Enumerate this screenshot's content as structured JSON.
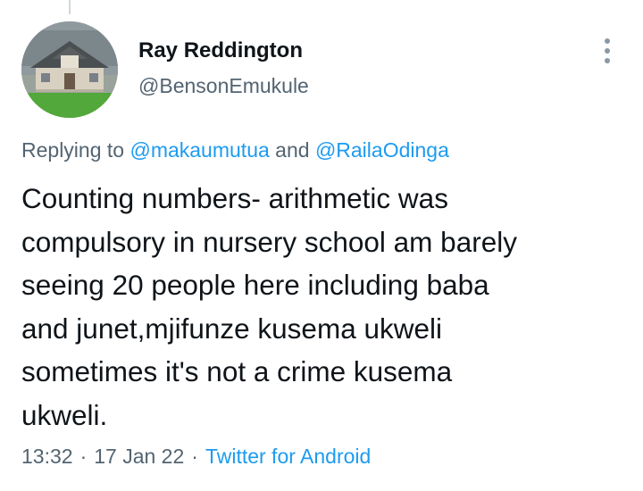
{
  "author": {
    "display_name": "Ray Reddington",
    "handle": "@BensonEmukule"
  },
  "reply": {
    "prefix": "Replying to",
    "mention_1": "@makaumutua",
    "conjunction": "and",
    "mention_2": "@RailaOdinga"
  },
  "tweet": {
    "lines": [
      "Counting numbers- arithmetic was",
      "compulsory in nursery school am barely",
      "seeing 20 people here including baba",
      "and junet,mjifunze kusema ukweli",
      "sometimes it's not a crime kusema",
      "ukweli."
    ]
  },
  "meta": {
    "time": "13:32",
    "separator": "·",
    "date": "17 Jan 22",
    "source": "Twitter for Android"
  },
  "icons": {
    "more": "more-vertical-icon"
  },
  "colors": {
    "link": "#1d9bf0",
    "secondary_text": "#536471",
    "primary_text": "#0f1419"
  }
}
